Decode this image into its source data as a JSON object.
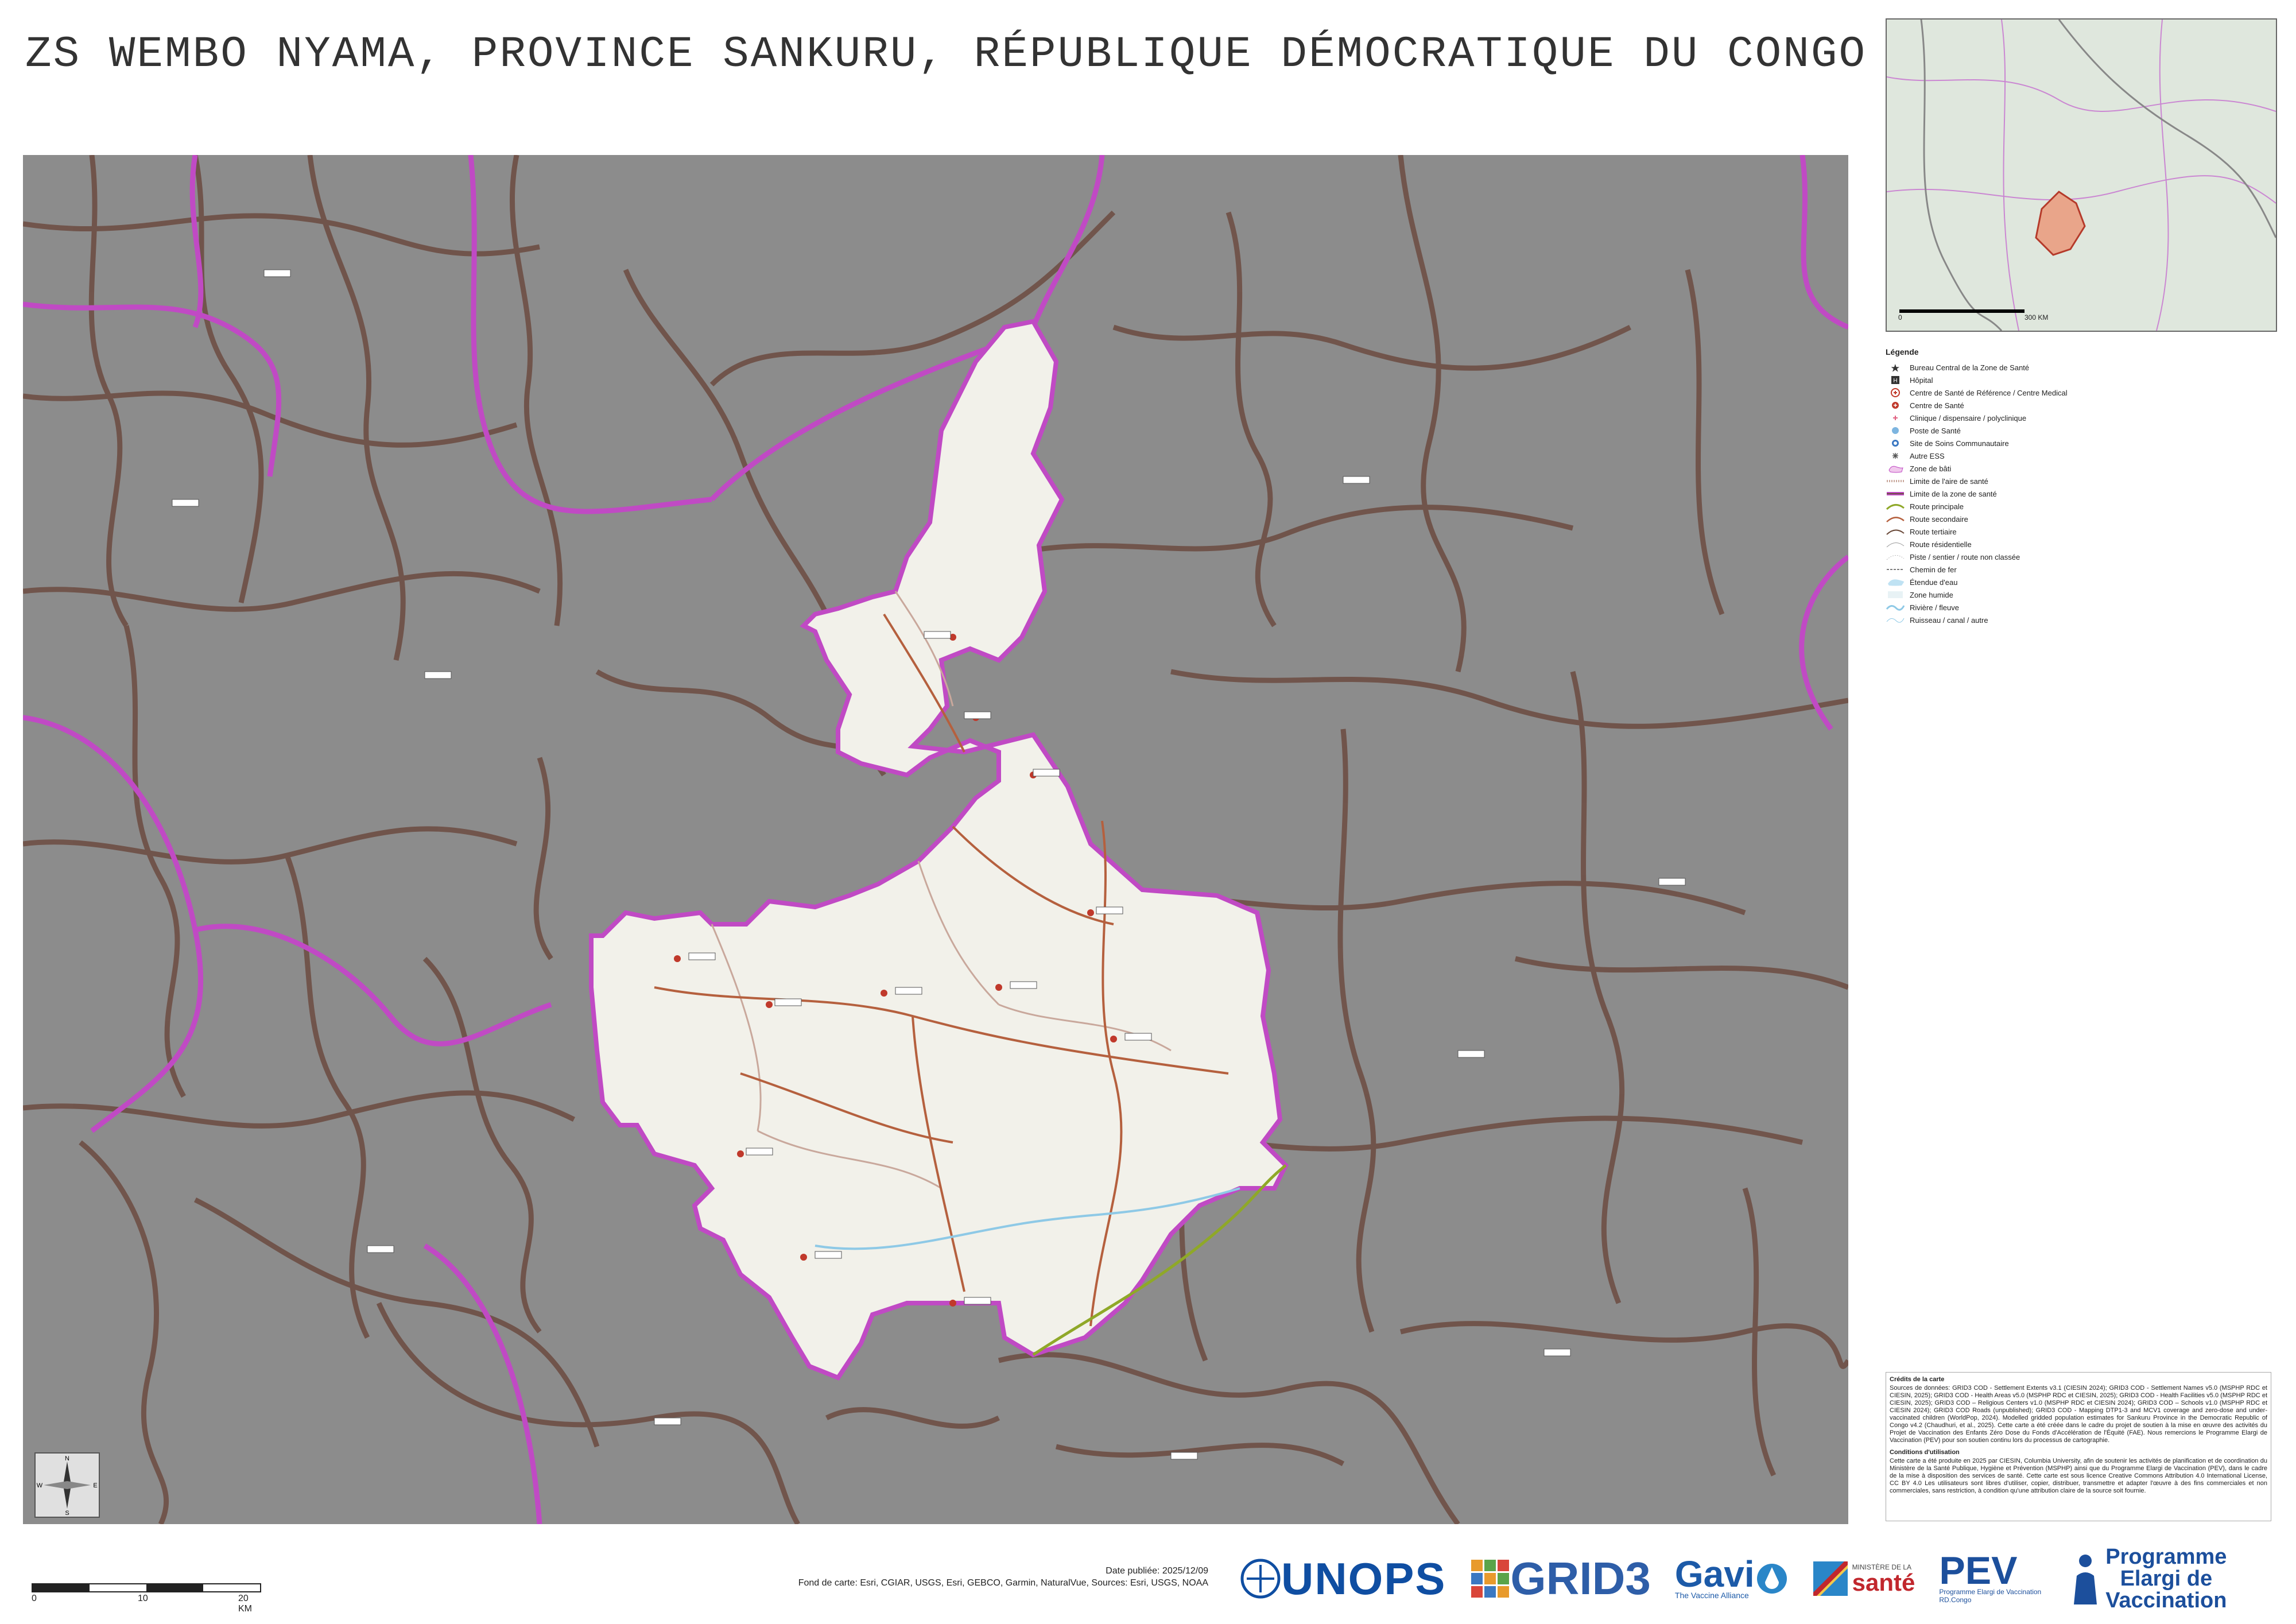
{
  "title": "ZS WEMBO NYAMA, PROVINCE SANKURU, RÉPUBLIQUE DÉMOCRATIQUE DU CONGO",
  "inset": {
    "scale_label": "300 KM",
    "scale_zero": "0"
  },
  "legend": {
    "title": "Légende",
    "items": [
      {
        "label": "Bureau Central de la Zone de Santé",
        "icon": "star-icon"
      },
      {
        "label": "Hôpital",
        "icon": "hospital-icon"
      },
      {
        "label": "Centre de Santé de Référence / Centre Medical",
        "icon": "referral-center-icon"
      },
      {
        "label": "Centre de Santé",
        "icon": "health-center-icon"
      },
      {
        "label": "Clinique / dispensaire / polyclinique",
        "icon": "clinic-icon"
      },
      {
        "label": "Poste de Santé",
        "icon": "health-post-icon"
      },
      {
        "label": "Site de Soins Communautaire",
        "icon": "community-care-icon"
      },
      {
        "label": "Autre ESS",
        "icon": "other-facility-icon"
      },
      {
        "label": "Zone de bâti",
        "icon": "built-area-icon"
      },
      {
        "label": "Limite de l'aire de santé",
        "icon": "health-area-boundary-icon"
      },
      {
        "label": "Limite de la zone de santé",
        "icon": "health-zone-boundary-icon"
      },
      {
        "label": "Route principale",
        "icon": "primary-road-icon"
      },
      {
        "label": "Route secondaire",
        "icon": "secondary-road-icon"
      },
      {
        "label": "Route tertiaire",
        "icon": "tertiary-road-icon"
      },
      {
        "label": "Route résidentielle",
        "icon": "residential-road-icon"
      },
      {
        "label": "Piste / sentier / route non classée",
        "icon": "track-icon"
      },
      {
        "label": "Chemin de fer",
        "icon": "railway-icon"
      },
      {
        "label": "Étendue d'eau",
        "icon": "water-body-icon"
      },
      {
        "label": "Zone humide",
        "icon": "wetland-icon"
      },
      {
        "label": "Rivière / fleuve",
        "icon": "river-icon"
      },
      {
        "label": "Ruisseau / canal / autre",
        "icon": "stream-icon"
      }
    ]
  },
  "credits": {
    "heading1": "Crédits de la carte",
    "text1": "Sources de données: GRID3 COD - Settlement Extents v3.1 (CIESIN 2024); GRID3 COD - Settlement Names v5.0 (MSPHP RDC et CIESIN, 2025); GRID3 COD - Health Areas v5.0 (MSPHP RDC et CIESIN, 2025); GRID3 COD - Health Facilities v5.0 (MSPHP RDC et CIESIN, 2025); GRID3 COD – Religious Centers v1.0 (MSPHP RDC et CIESIN 2024); GRID3 COD – Schools v1.0 (MSPHP RDC et CIESIN 2024); GRID3 COD Roads (unpublished); GRID3 COD - Mapping DTP1-3 and MCV1 coverage and zero-dose and under-vaccinated children (WorldPop, 2024). Modelled gridded population estimates for Sankuru Province in the Democratic Republic of Congo v4.2 (Chaudhuri, et al., 2025). Cette carte a été créée dans le cadre du projet de soutien à la mise en œuvre des activités du Projet de Vaccination des Enfants Zéro Dose du Fonds d'Accélération de l'Équité (FAE). Nous remercions le Programme Elargi de Vaccination (PEV) pour son soutien continu lors du processus de cartographie.",
    "heading2": "Conditions d'utilisation",
    "text2": "Cette carte a été produite en 2025 par CIESIN, Columbia University, afin de soutenir les activités de planification et de coordination du Ministère de la Santé Publique, Hygiène et Prévention (MSPHP) ainsi que du Programme Elargi de Vaccination (PEV), dans le cadre de la mise à disposition des services de santé. Cette carte est sous licence Creative Commons Attribution 4.0 International License, CC BY 4.0 Les utilisateurs sont libres d'utiliser, copier, distribuer, transmettre et adapter l'œuvre à des fins commerciales et non commerciales, sans restriction, à condition qu'une attribution claire de la source soit fournie."
  },
  "north_arrow": {
    "n": "N",
    "s": "S",
    "e": "E",
    "w": "W"
  },
  "scalebar": {
    "l0": "0",
    "l1": "10",
    "l2": "20 KM"
  },
  "pubinfo": {
    "date": "Date publiée: 2025/12/09",
    "basemap": "Fond de carte: Esri, CGIAR, USGS, Esri, GEBCO, Garmin, NaturalVue, Sources: Esri, USGS, NOAA"
  },
  "logos": {
    "unops": "UNOPS",
    "grid3": "GRID3",
    "gavi": "Gavi",
    "gavi_sub": "The Vaccine Alliance",
    "sante_small": "MINISTÈRE DE LA",
    "sante": "santé",
    "pev": "PEV",
    "pev_sub1": "Programme Elargi de Vaccination",
    "pev_sub2": "RD.Congo",
    "prog1": "Programme",
    "prog2": "Elargi de",
    "prog3": "Vaccination"
  },
  "colors": {
    "background_gray": "#8c8c8c",
    "area_boundary": "#6e4f45",
    "zone_boundary": "#c04ac4",
    "focus_zone": "#f2f1ea",
    "road_secondary": "#b5603e",
    "road_primary": "#8fa828",
    "river": "#8ec9e6"
  }
}
